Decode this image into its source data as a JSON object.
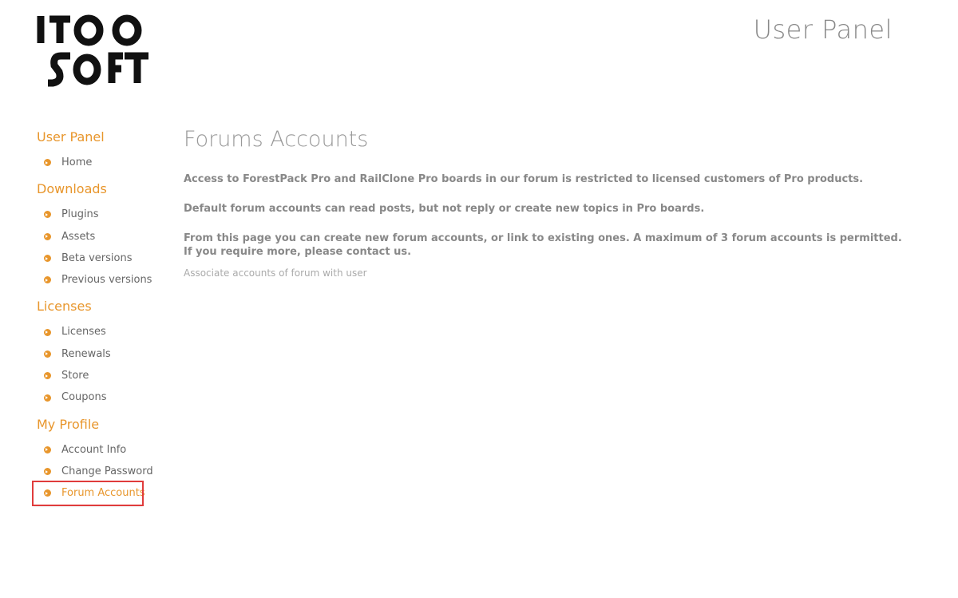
{
  "brand": {
    "logo_text": "ITOO SOFT",
    "accent_color": "#e8962c"
  },
  "header": {
    "title": "User Panel"
  },
  "sidebar": {
    "sections": [
      {
        "title": "User Panel",
        "items": [
          {
            "label": "Home"
          }
        ]
      },
      {
        "title": "Downloads",
        "items": [
          {
            "label": "Plugins"
          },
          {
            "label": "Assets"
          },
          {
            "label": "Beta versions"
          },
          {
            "label": "Previous versions"
          }
        ]
      },
      {
        "title": "Licenses",
        "items": [
          {
            "label": "Licenses"
          },
          {
            "label": "Renewals"
          },
          {
            "label": "Store"
          },
          {
            "label": "Coupons"
          }
        ]
      },
      {
        "title": "My Profile",
        "items": [
          {
            "label": "Account Info"
          },
          {
            "label": "Change Password"
          },
          {
            "label": "Forum Accounts",
            "active": true
          }
        ]
      }
    ],
    "bullet_icon": "chevron-right-circle-icon"
  },
  "main": {
    "title": "Forums Accounts",
    "paragraphs": [
      "Access to ForestPack Pro and RailClone Pro boards in our forum is restricted to licensed customers of Pro products.",
      "Default forum accounts can read posts, but not reply or create new topics in Pro boards.",
      "From this page you can create new forum accounts, or link to existing ones. A maximum of 3 forum accounts is permitted. If you require more, please contact us."
    ],
    "associate_text": "Associate accounts of forum with user"
  }
}
